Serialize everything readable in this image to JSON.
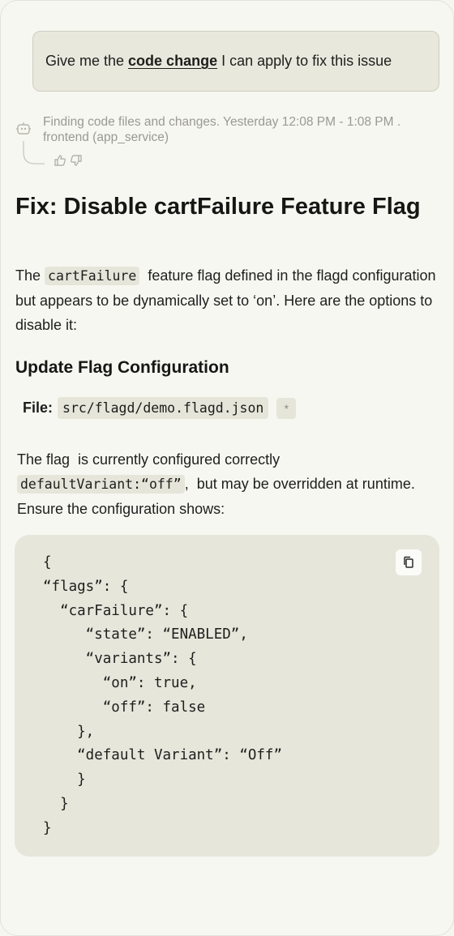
{
  "user_message": {
    "prefix": "Give me the ",
    "highlight": "code change",
    "suffix": " I can apply to fix this issue"
  },
  "assistant": {
    "status": "Finding code files and changes. Yesterday 12:08 PM - 1:08 PM . frontend (app_service)",
    "icons": [
      "robot-icon",
      "thumbs-up-icon",
      "thumbs-down-icon"
    ]
  },
  "answer": {
    "title": "Fix: Disable cartFailure Feature Flag",
    "intro_before": "The ",
    "intro_code": "cartFailure",
    "intro_after": "  feature flag defined in the flagd configuration but appears to be dynamically set to ‘on’. Here are the options to disable it:",
    "section_title": "Update Flag Configuration",
    "file_label": "File:",
    "file_path": "src/flagd/demo.flagd.json",
    "file_badge": "*",
    "desc_before": "The flag  is currently configured correctly ",
    "desc_code": "defaultVariant:“off”",
    "desc_after": ",  but may be overridden at runtime. Ensure the configuration shows:",
    "code": "{\n“flags”: {\n  “carFailure”: {\n     “state”: “ENABLED”,\n     “variants”: {\n       “on”: true,\n       “off”: false\n    },\n    “default Variant”: “Off”\n    }\n  }\n}",
    "copy_icon": "copy-icon"
  }
}
